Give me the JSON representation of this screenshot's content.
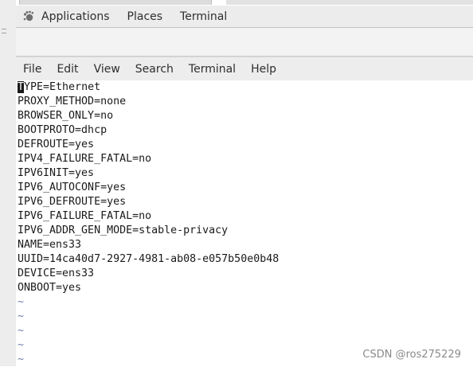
{
  "panel": {
    "applications_label": "Applications",
    "places_label": "Places",
    "terminal_label": "Terminal"
  },
  "menubar": {
    "file": "File",
    "edit": "Edit",
    "view": "View",
    "search": "Search",
    "terminal": "Terminal",
    "help": "Help"
  },
  "editor": {
    "cursor_char": "T",
    "first_line_rest": "YPE=Ethernet",
    "lines": [
      "PROXY_METHOD=none",
      "BROWSER_ONLY=no",
      "BOOTPROTO=dhcp",
      "DEFROUTE=yes",
      "IPV4_FAILURE_FATAL=no",
      "IPV6INIT=yes",
      "IPV6_AUTOCONF=yes",
      "IPV6_DEFROUTE=yes",
      "IPV6_FAILURE_FATAL=no",
      "IPV6_ADDR_GEN_MODE=stable-privacy",
      "NAME=ens33",
      "UUID=14ca40d7-2927-4981-ab08-e057b50e0b48",
      "DEVICE=ens33",
      "ONBOOT=yes"
    ],
    "empty_marker": "~",
    "tilde_count": 5
  },
  "watermark": "CSDN @ros275229",
  "colors": {
    "tilde": "#6a7fa8",
    "text": "#1a1a1a",
    "panel_bg": "#ececec"
  }
}
